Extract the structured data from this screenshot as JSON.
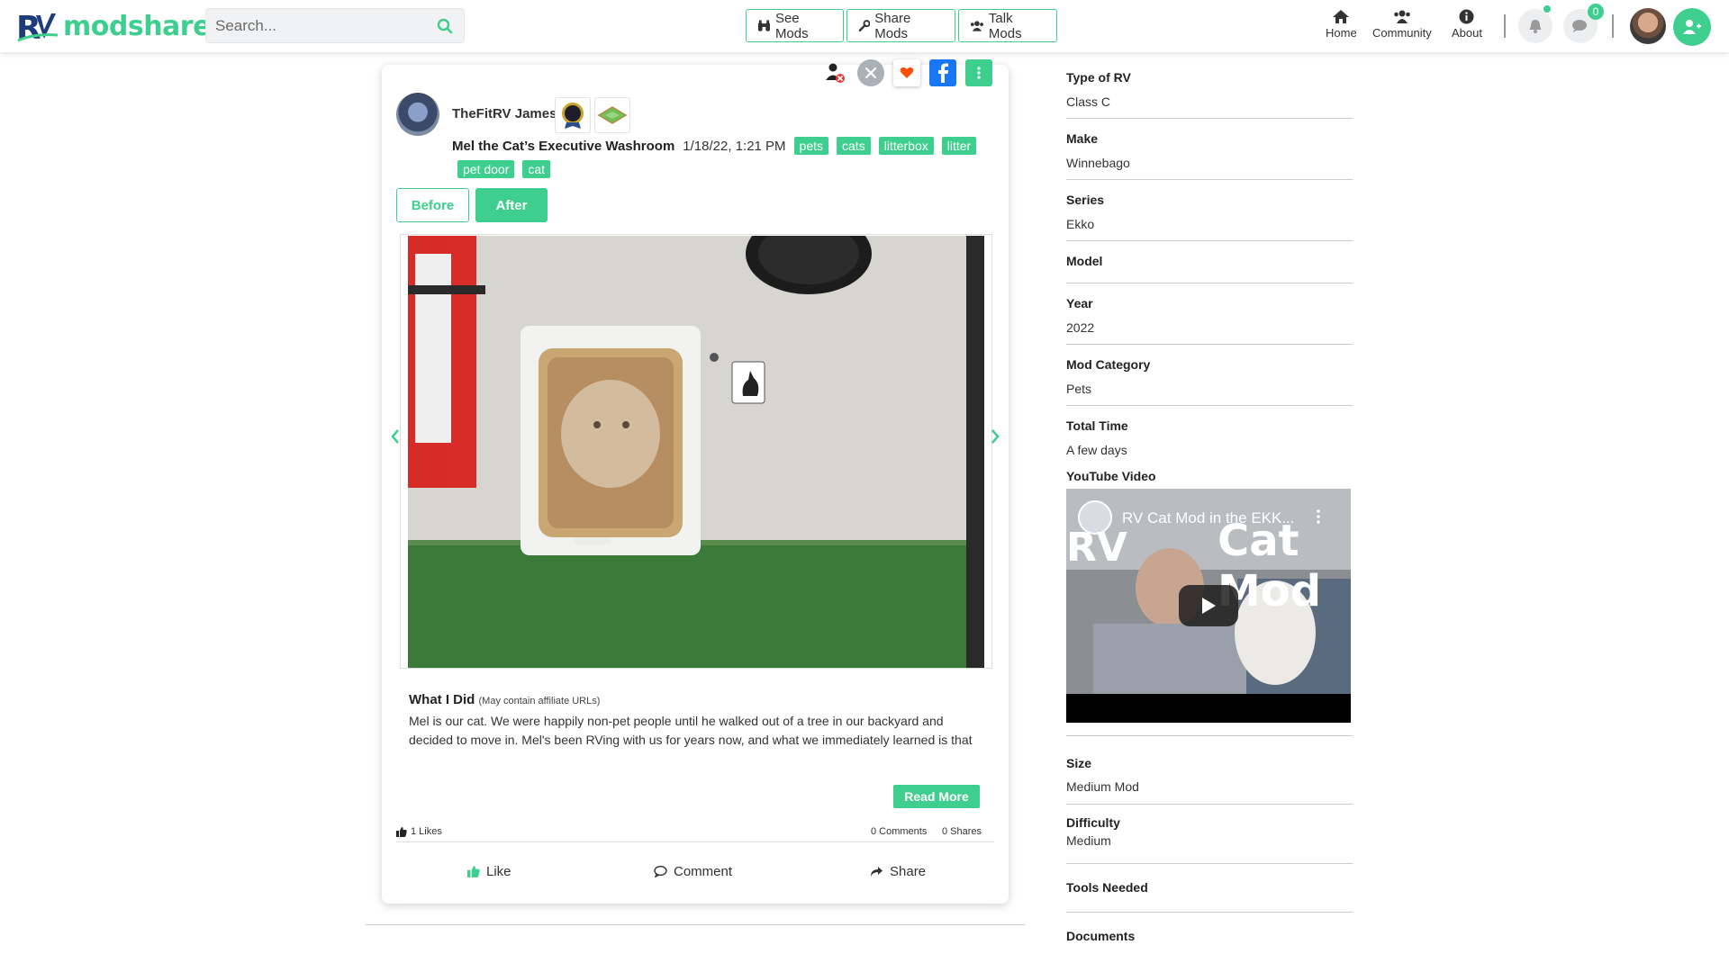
{
  "brand": {
    "logo_text": "modshare",
    "accent_color": "#3ecf8e",
    "logo_blue": "#1c3d7a"
  },
  "search": {
    "placeholder": "Search..."
  },
  "nav": {
    "see_mods": "See Mods",
    "share_mods": "Share Mods",
    "talk_mods": "Talk Mods"
  },
  "top_right": {
    "home": "Home",
    "community": "Community",
    "about": "About",
    "messages_count": "0"
  },
  "post": {
    "author": "TheFitRV James",
    "title": "Mel the Cat’s Executive Washroom",
    "date": "1/18/22, 1:21 PM",
    "tags": [
      "pets",
      "cats",
      "litterbox",
      "litter",
      "pet door",
      "cat"
    ],
    "before_label": "Before",
    "after_label": "After",
    "what_i_did_label": "What I Did",
    "affiliate_note": "(May contain affiliate URLs)",
    "body": "Mel is our cat. We were happily non-pet people until he walked out of a tree in our backyard and decided to move in. Mel's been RVing with us for years now, and what we immediately learned is that",
    "read_more": "Read More",
    "likes": "1 Likes",
    "comments": "0 Comments",
    "shares": "0 Shares",
    "like_btn": "Like",
    "comment_btn": "Comment",
    "share_btn": "Share"
  },
  "specs": [
    {
      "key": "Type of RV",
      "value": "Class C"
    },
    {
      "key": "Make",
      "value": "Winnebago"
    },
    {
      "key": "Series",
      "value": "Ekko"
    },
    {
      "key": "Model",
      "value": ""
    },
    {
      "key": "Year",
      "value": "2022"
    },
    {
      "key": "Mod Category",
      "value": "Pets"
    },
    {
      "key": "Total Time",
      "value": "A few days"
    }
  ],
  "youtube": {
    "label": "YouTube Video",
    "title": "RV Cat Mod in the EKK...",
    "thumb_text_left": "RV",
    "thumb_text_right": "Cat Mod"
  },
  "specs2": [
    {
      "key": "Size",
      "value": "Medium Mod"
    },
    {
      "key": "Difficulty",
      "value": "Medium"
    },
    {
      "key": "Tools Needed",
      "value": ""
    },
    {
      "key": "Documents",
      "value": ""
    }
  ]
}
